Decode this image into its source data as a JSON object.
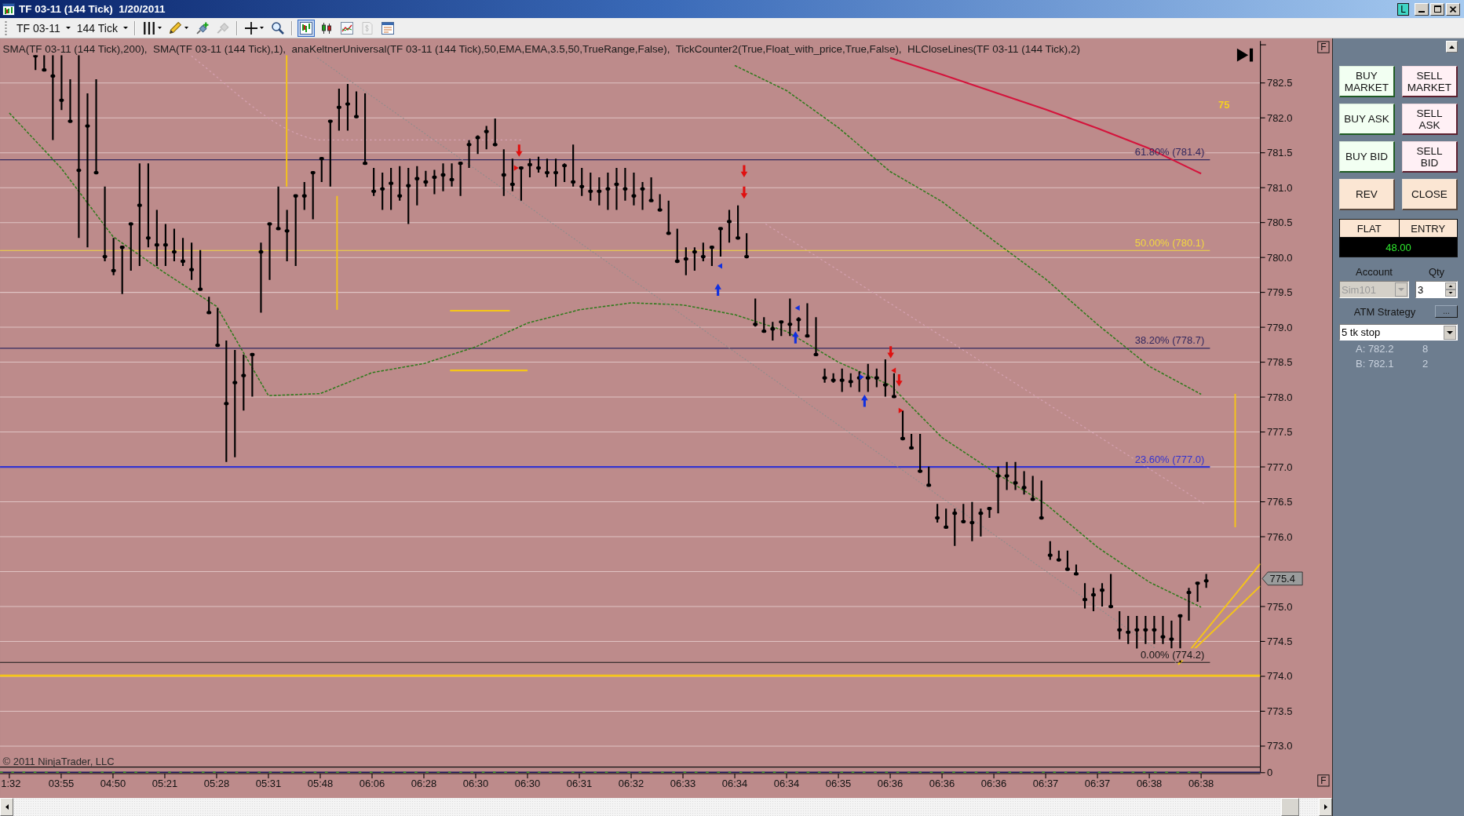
{
  "window": {
    "title": "TF 03-11 (144 Tick)  1/20/2011",
    "link_button": "L"
  },
  "toolbar": {
    "instrument": "TF 03-11",
    "period": "144 Tick",
    "tool_groups": [
      [
        {
          "kind": "style",
          "menu": true,
          "on": false,
          "disabled": false
        },
        {
          "kind": "draw",
          "menu": true,
          "on": false,
          "disabled": false
        },
        {
          "kind": "attach",
          "menu": false,
          "on": false,
          "disabled": false
        },
        {
          "kind": "detach",
          "menu": false,
          "on": false,
          "disabled": true
        }
      ],
      [
        {
          "kind": "crosshair",
          "menu": true,
          "on": false,
          "disabled": false
        },
        {
          "kind": "zoom",
          "menu": false,
          "on": false,
          "disabled": false
        }
      ],
      [
        {
          "kind": "trader",
          "menu": false,
          "on": true,
          "disabled": false
        },
        {
          "kind": "strategy",
          "menu": false,
          "on": false,
          "disabled": false
        },
        {
          "kind": "indicator",
          "menu": false,
          "on": false,
          "disabled": false
        },
        {
          "kind": "account",
          "menu": false,
          "on": false,
          "disabled": true
        },
        {
          "kind": "properties",
          "menu": false,
          "on": false,
          "disabled": false
        }
      ]
    ]
  },
  "chart": {
    "legend": "SMA(TF 03-11 (144 Tick),200),  SMA(TF 03-11 (144 Tick),1),  anaKeltnerUniversal(TF 03-11 (144 Tick),50,EMA,EMA,3.5,50,TrueRange,False),  TickCounter2(True,Float_with_price,True,False),  HLCloseLines(TF 03-11 (144 Tick),2)",
    "counter": "75",
    "last_price": "775.4",
    "indicator_axis_label": "0",
    "copyright": "© 2011 NinjaTrader, LLC",
    "scale_buttons": [
      "F",
      "F"
    ],
    "chart_data": {
      "type": "line",
      "grid": true,
      "categories": [
        "1:32",
        "03:55",
        "04:50",
        "05:21",
        "05:28",
        "05:31",
        "05:48",
        "06:06",
        "06:28",
        "06:30",
        "06:30",
        "06:31",
        "06:32",
        "06:33",
        "06:34",
        "06:34",
        "06:35",
        "06:36",
        "06:36",
        "06:36",
        "06:37",
        "06:37",
        "06:38",
        "06:38"
      ],
      "ylim": [
        772.7,
        783.1
      ],
      "yticks": [
        {
          "value": 782.5,
          "label": "782.5"
        },
        {
          "value": 782,
          "label": "782.0"
        },
        {
          "value": 781.5,
          "label": "781.5"
        },
        {
          "value": 781,
          "label": "781.0"
        },
        {
          "value": 780.5,
          "label": "780.5"
        },
        {
          "value": 780,
          "label": "780.0"
        },
        {
          "value": 779.5,
          "label": "779.5"
        },
        {
          "value": 779,
          "label": "779.0"
        },
        {
          "value": 778.5,
          "label": "778.5"
        },
        {
          "value": 778,
          "label": "778.0"
        },
        {
          "value": 777.5,
          "label": "777.5"
        },
        {
          "value": 777,
          "label": "777.0"
        },
        {
          "value": 776.5,
          "label": "776.5"
        },
        {
          "value": 776,
          "label": "776.0"
        },
        {
          "value": 775,
          "label": "775.0"
        },
        {
          "value": 774.5,
          "label": "774.5"
        },
        {
          "value": 774,
          "label": "774.0"
        },
        {
          "value": 773.5,
          "label": "773.5"
        },
        {
          "value": 773,
          "label": "773.0"
        }
      ],
      "ref_lines": [
        {
          "axis": "y",
          "value": 781.4,
          "label": "61.80% (781.4)",
          "color": "#33285e"
        },
        {
          "axis": "y",
          "value": 780.1,
          "label": "50.00% (780.1)",
          "color": "#f2d840"
        },
        {
          "axis": "y",
          "value": 778.7,
          "label": "38.20% (778.7)",
          "color": "#33285e"
        },
        {
          "axis": "y",
          "value": 777.0,
          "label": "23.60% (777.0)",
          "color": "#3434d0"
        },
        {
          "axis": "y",
          "value": 774.2,
          "label": "0.00% (774.2)",
          "color": "#141414"
        }
      ],
      "series": [
        {
          "color": "#d4143c",
          "line_style": "solid",
          "values": [
            null,
            null,
            null,
            null,
            null,
            null,
            null,
            null,
            null,
            null,
            null,
            null,
            null,
            null,
            null,
            null,
            null,
            782.86,
            782.62,
            782.37,
            782.12,
            781.85,
            781.56,
            781.2
          ]
        },
        {
          "color": "#2f7a1c",
          "line_style": "dashed",
          "values": [
            782.07,
            781.28,
            780.3,
            779.78,
            779.3,
            778.02,
            778.05,
            778.35,
            778.48,
            778.72,
            779.06,
            779.25,
            779.35,
            779.32,
            779.18,
            778.94,
            778.5,
            778.17,
            777.42,
            776.93,
            776.47,
            775.85,
            775.35,
            774.99
          ]
        },
        {
          "color": "#2f7a1c",
          "line_style": "dashed",
          "values": [
            null,
            null,
            null,
            null,
            null,
            null,
            null,
            null,
            null,
            null,
            null,
            null,
            null,
            null,
            782.75,
            782.39,
            781.86,
            781.23,
            780.8,
            780.24,
            779.69,
            779.04,
            778.44,
            778.04
          ]
        }
      ]
    }
  },
  "chart_trader": {
    "buttons": [
      {
        "lines": [
          "BUY",
          "MARKET"
        ],
        "kind": "buy"
      },
      {
        "lines": [
          "SELL",
          "MARKET"
        ],
        "kind": "sell"
      },
      {
        "lines": [
          "BUY ASK"
        ],
        "kind": "buy"
      },
      {
        "lines": [
          "SELL",
          "ASK"
        ],
        "kind": "sell"
      },
      {
        "lines": [
          "BUY BID"
        ],
        "kind": "buy"
      },
      {
        "lines": [
          "SELL",
          "BID"
        ],
        "kind": "sell"
      },
      {
        "lines": [
          "REV"
        ],
        "kind": "reverse"
      },
      {
        "lines": [
          "CLOSE"
        ],
        "kind": "flatten"
      }
    ],
    "position": {
      "status": "FLAT",
      "mode": "ENTRY",
      "pnl": "48.00"
    },
    "account": {
      "label": "Account",
      "value": "Sim101",
      "disabled": true
    },
    "quantity": {
      "label": "Qty",
      "value": "3"
    },
    "atm_strategy": {
      "label": "ATM Strategy",
      "more_button": "...",
      "value": "5 tk stop"
    },
    "quotes": [
      {
        "price": "A: 782.2",
        "size": "8"
      },
      {
        "price": "B: 782.1",
        "size": "2"
      }
    ]
  }
}
